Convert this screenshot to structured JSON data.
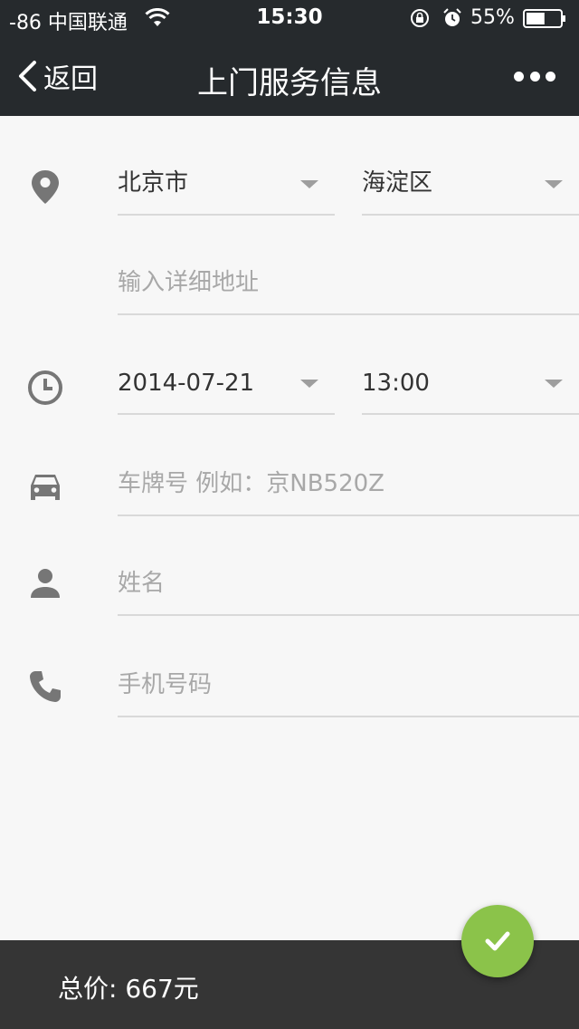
{
  "status_bar": {
    "carrier": "-86 中国联通",
    "time": "15:30",
    "battery_percent": "55%",
    "battery_level": 0.55
  },
  "nav": {
    "back_label": "返回",
    "title": "上门服务信息",
    "more_icon": "more-dots-icon"
  },
  "form": {
    "city": "北京市",
    "district": "海淀区",
    "address_placeholder": "输入详细地址",
    "date": "2014-07-21",
    "time": "13:00",
    "plate_placeholder": "车牌号 例如：京NB520Z",
    "name_placeholder": "姓名",
    "phone_placeholder": "手机号码"
  },
  "icons": {
    "location": "location-pin-icon",
    "clock": "clock-icon",
    "car": "car-icon",
    "person": "person-icon",
    "phone": "phone-icon",
    "confirm": "checkmark-icon"
  },
  "footer": {
    "total_label": "总价:",
    "total_value": "667元"
  },
  "colors": {
    "header_bg": "#262a2d",
    "footer_bg": "#353535",
    "accent": "#8bc34a",
    "page_bg": "#f7f7f7"
  }
}
